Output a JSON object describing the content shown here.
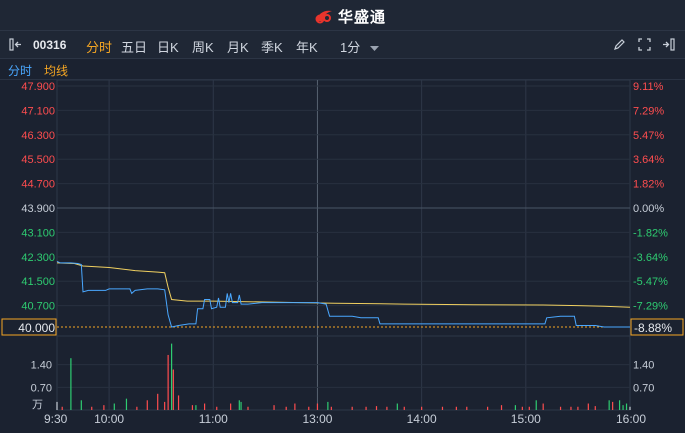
{
  "app": {
    "name": "华盛通"
  },
  "toolbar": {
    "stock_code": "00316",
    "periods": [
      "分时",
      "五日",
      "日K",
      "周K",
      "月K",
      "季K",
      "年K"
    ],
    "active_period": "分时",
    "interval": "1分"
  },
  "subtabs": {
    "intraday": "分时",
    "avg_line": "均线"
  },
  "colors": {
    "accent": "#f5a623",
    "up": "#ff4d4f",
    "down": "#2ecc71",
    "price_line": "#4aa8ff",
    "avg_line": "#f0d060",
    "flat": "#c7ced8"
  },
  "chart_data": {
    "type": "line",
    "prev_close": 43.9,
    "current_price_label": "40.000",
    "current_pct_label": "-8.88%",
    "price_ticks": [
      "47.900",
      "47.100",
      "46.300",
      "45.500",
      "44.700",
      "43.900",
      "43.100",
      "42.300",
      "41.500",
      "40.700",
      "40.000"
    ],
    "price_tick_values": [
      47.9,
      47.1,
      46.3,
      45.5,
      44.7,
      43.9,
      43.1,
      42.3,
      41.5,
      40.7,
      40.0
    ],
    "pct_ticks": [
      "9.11%",
      "7.29%",
      "5.47%",
      "3.64%",
      "1.82%",
      "0.00%",
      "-1.82%",
      "-3.64%",
      "-5.47%",
      "-7.29%",
      "-8.88%"
    ],
    "time_labels": [
      "9:30",
      "10:00",
      "11:00",
      "13:00",
      "14:00",
      "15:00",
      "16:00"
    ],
    "volume_ticks": [
      "1.40",
      "0.70"
    ],
    "volume_tick_values": [
      1.4,
      0.7
    ],
    "volume_unit": "万",
    "ylim": [
      40.0,
      47.9
    ],
    "volume_ylim": [
      0,
      2.1
    ],
    "price_series": [
      [
        0,
        42.15
      ],
      [
        2,
        42.1
      ],
      [
        8,
        42.1
      ],
      [
        12,
        42.08
      ],
      [
        14,
        42.05
      ],
      [
        15,
        41.15
      ],
      [
        18,
        41.2
      ],
      [
        28,
        41.2
      ],
      [
        30,
        41.25
      ],
      [
        42,
        41.25
      ],
      [
        43,
        41.1
      ],
      [
        45,
        41.2
      ],
      [
        52,
        41.25
      ],
      [
        58,
        41.25
      ],
      [
        62,
        41.22
      ],
      [
        64,
        40.4
      ],
      [
        66,
        40.0
      ],
      [
        70,
        40.05
      ],
      [
        76,
        40.1
      ],
      [
        80,
        40.1
      ],
      [
        81,
        40.6
      ],
      [
        84,
        40.6
      ],
      [
        85,
        40.9
      ],
      [
        88,
        40.9
      ],
      [
        89,
        40.6
      ],
      [
        92,
        40.65
      ],
      [
        93,
        40.95
      ],
      [
        94,
        40.65
      ],
      [
        97,
        40.65
      ],
      [
        98,
        41.1
      ],
      [
        99,
        40.8
      ],
      [
        100,
        41.1
      ],
      [
        101,
        40.8
      ],
      [
        104,
        40.8
      ],
      [
        105,
        41.05
      ],
      [
        106,
        40.75
      ],
      [
        110,
        40.75
      ],
      [
        118,
        40.8
      ],
      [
        150,
        40.8
      ],
      [
        155,
        40.75
      ],
      [
        157,
        40.35
      ],
      [
        170,
        40.35
      ],
      [
        175,
        40.3
      ],
      [
        180,
        40.3
      ],
      [
        185,
        40.3
      ],
      [
        186,
        40.1
      ],
      [
        200,
        40.1
      ],
      [
        230,
        40.1
      ],
      [
        274,
        40.1
      ],
      [
        280,
        40.1
      ],
      [
        281,
        40.1
      ],
      [
        282,
        40.3
      ],
      [
        290,
        40.35
      ],
      [
        298,
        40.35
      ],
      [
        299,
        40.05
      ],
      [
        310,
        40.05
      ],
      [
        315,
        40.0
      ],
      [
        330,
        40.0
      ]
    ],
    "avg_series": [
      [
        0,
        42.1
      ],
      [
        10,
        42.08
      ],
      [
        15,
        42.0
      ],
      [
        30,
        41.95
      ],
      [
        45,
        41.85
      ],
      [
        58,
        41.8
      ],
      [
        62,
        41.78
      ],
      [
        64,
        41.3
      ],
      [
        66,
        40.9
      ],
      [
        75,
        40.85
      ],
      [
        90,
        40.85
      ],
      [
        120,
        40.82
      ],
      [
        160,
        40.78
      ],
      [
        200,
        40.75
      ],
      [
        240,
        40.73
      ],
      [
        280,
        40.72
      ],
      [
        300,
        40.7
      ],
      [
        315,
        40.68
      ],
      [
        330,
        40.65
      ]
    ],
    "volume_bars": [
      [
        0,
        0.25,
        "flat"
      ],
      [
        3,
        0.1,
        "up"
      ],
      [
        8,
        1.6,
        "down"
      ],
      [
        14,
        0.3,
        "down"
      ],
      [
        20,
        0.1,
        "up"
      ],
      [
        27,
        0.15,
        "up"
      ],
      [
        33,
        0.2,
        "down"
      ],
      [
        40,
        0.35,
        "down"
      ],
      [
        46,
        0.1,
        "up"
      ],
      [
        52,
        0.3,
        "up"
      ],
      [
        58,
        0.5,
        "up"
      ],
      [
        62,
        0.25,
        "up"
      ],
      [
        64,
        1.7,
        "up"
      ],
      [
        66,
        2.05,
        "down"
      ],
      [
        67,
        1.25,
        "up"
      ],
      [
        70,
        0.45,
        "up"
      ],
      [
        78,
        0.15,
        "up"
      ],
      [
        80,
        0.15,
        "down"
      ],
      [
        85,
        0.2,
        "up"
      ],
      [
        92,
        0.1,
        "up"
      ],
      [
        100,
        0.2,
        "up"
      ],
      [
        105,
        0.3,
        "down"
      ],
      [
        106,
        0.25,
        "down"
      ],
      [
        110,
        0.1,
        "up"
      ],
      [
        125,
        0.15,
        "up"
      ],
      [
        132,
        0.1,
        "up"
      ],
      [
        137,
        0.2,
        "up"
      ],
      [
        145,
        0.1,
        "up"
      ],
      [
        150,
        0.2,
        "up"
      ],
      [
        156,
        0.25,
        "down"
      ],
      [
        158,
        0.1,
        "up"
      ],
      [
        170,
        0.1,
        "up"
      ],
      [
        178,
        0.1,
        "up"
      ],
      [
        184,
        0.12,
        "up"
      ],
      [
        190,
        0.1,
        "up"
      ],
      [
        196,
        0.2,
        "down"
      ],
      [
        200,
        0.1,
        "up"
      ],
      [
        210,
        0.1,
        "up"
      ],
      [
        222,
        0.1,
        "up"
      ],
      [
        230,
        0.1,
        "up"
      ],
      [
        236,
        0.1,
        "up"
      ],
      [
        248,
        0.1,
        "up"
      ],
      [
        256,
        0.15,
        "up"
      ],
      [
        264,
        0.15,
        "down"
      ],
      [
        268,
        0.1,
        "up"
      ],
      [
        272,
        0.1,
        "up"
      ],
      [
        276,
        0.3,
        "down"
      ],
      [
        280,
        0.2,
        "up"
      ],
      [
        290,
        0.1,
        "up"
      ],
      [
        296,
        0.1,
        "up"
      ],
      [
        300,
        0.1,
        "up"
      ],
      [
        306,
        0.2,
        "up"
      ],
      [
        310,
        0.12,
        "up"
      ],
      [
        318,
        0.3,
        "down"
      ],
      [
        320,
        0.25,
        "up"
      ],
      [
        324,
        0.3,
        "down"
      ],
      [
        326,
        0.15,
        "down"
      ],
      [
        328,
        0.2,
        "down"
      ],
      [
        330,
        0.1,
        "flat"
      ]
    ]
  }
}
